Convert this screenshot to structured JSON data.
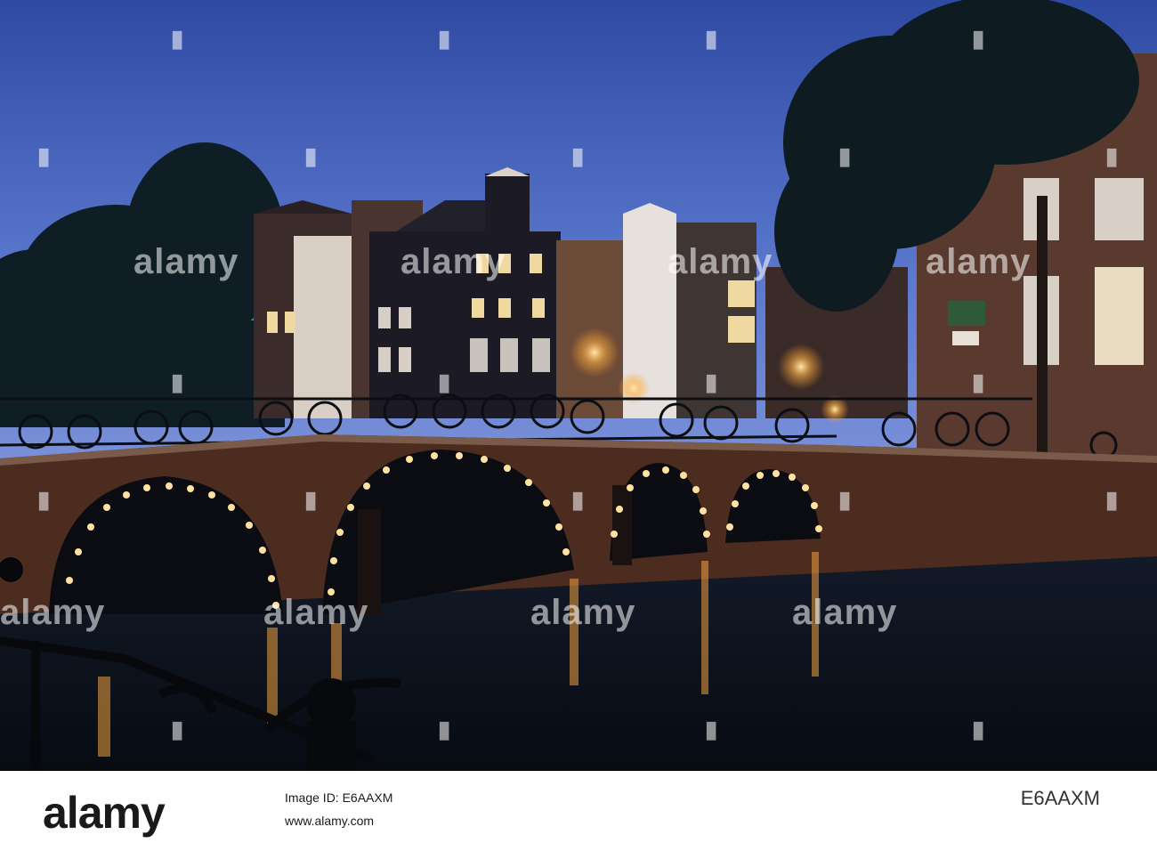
{
  "photo": {
    "scene": "amsterdam-canal-bridge-at-dusk",
    "colors": {
      "sky_top": "#3a55a8",
      "sky_bottom": "#6f8ad6",
      "water": "#0c1420",
      "bridge_brick": "#5a3222",
      "lights": "#ffd27a"
    }
  },
  "watermark": {
    "text": "alamy",
    "repeat_text": "alamy"
  },
  "footer": {
    "brand": "alamy",
    "image_id": "E6AAXM",
    "line1": "Image ID: E6AAXM",
    "line2": "www.alamy.com"
  }
}
